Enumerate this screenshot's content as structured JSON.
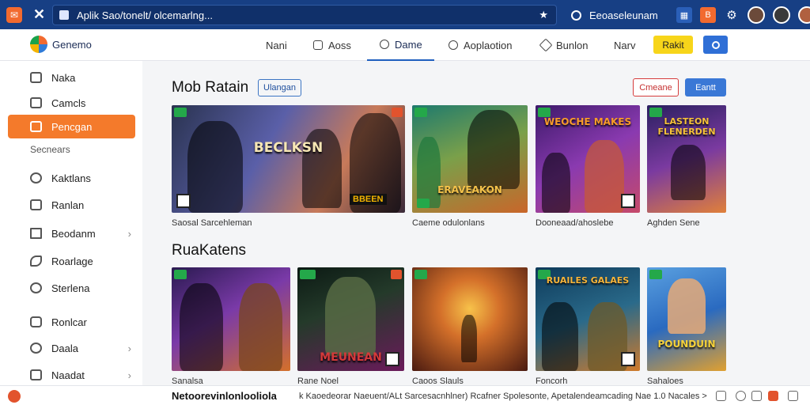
{
  "browser": {
    "url": "Aplik Sao/tonelt/ olcemarlng...",
    "search": "Eeoaseleunam"
  },
  "header": {
    "brand": "Genemo",
    "nav": [
      {
        "label": "Nani"
      },
      {
        "label": "Aoss"
      },
      {
        "label": "Dame"
      },
      {
        "label": "Aoplaotion"
      },
      {
        "label": "Bunlon"
      },
      {
        "label": "Narv"
      }
    ],
    "yellow_button": "Rakit"
  },
  "sidebar": {
    "items": [
      {
        "label": "Naka"
      },
      {
        "label": "Camcls"
      },
      {
        "label": "Pencgan"
      },
      {
        "label": "Kaktlans"
      },
      {
        "label": "Ranlan"
      },
      {
        "label": "Beodanm"
      },
      {
        "label": "Roarlage"
      },
      {
        "label": "Sterlena"
      },
      {
        "label": "Ronlcar"
      },
      {
        "label": "Daala"
      },
      {
        "label": "Naadat"
      }
    ],
    "section_label": "Secnears"
  },
  "section1": {
    "title": "Mob Ratain",
    "tag": "Ulangan",
    "btn_outline": "Cmeane",
    "btn_blue": "Eantt",
    "cards": [
      {
        "title": "BECLKSN",
        "caption": "Saosal Sarcehleman"
      },
      {
        "title": "ERAVEAKON",
        "caption": "Caeme odulonlans"
      },
      {
        "title": "WEOCHE MAKES",
        "caption": "Dooneaad/ahoslebe"
      },
      {
        "title": "LASTEON FLENERDEN",
        "caption": "Aghden Sene"
      }
    ],
    "card1_sub": "BBEEN"
  },
  "section2": {
    "title": "RuaKatens",
    "cards": [
      {
        "title": "",
        "caption": "Sanalsa"
      },
      {
        "title": "MEUNEAN",
        "caption": "Rane Noel"
      },
      {
        "title": "",
        "caption": "Caoos Slauls"
      },
      {
        "title": "RUAILES GALAES",
        "caption": "Foncorh"
      },
      {
        "title": "POUNDUIN",
        "caption": "Sahaloes"
      }
    ]
  },
  "footer": {
    "bold_text": "Netoorevinlonlooliola",
    "text": "k Kaoedeorar Naeuent/ALt Sarcesacnhlner) Rcafner Spolesonte, Apetalendeamcading Nae 1.0 Nacales >"
  },
  "colors": {
    "accent": "#f47a2b",
    "brand_blue": "#173f84",
    "button_blue": "#3a78d6"
  }
}
